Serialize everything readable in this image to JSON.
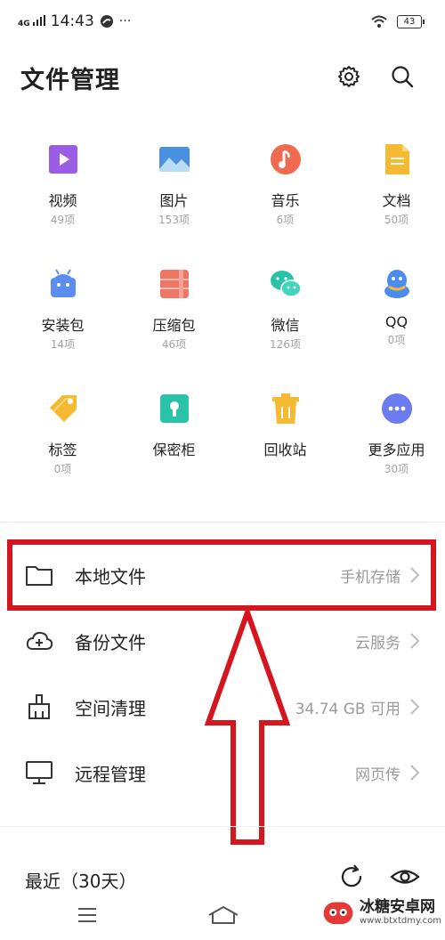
{
  "status_bar": {
    "network": "4G",
    "time": "14:43",
    "extra": "···",
    "battery": "43"
  },
  "header": {
    "title": "文件管理"
  },
  "categories": [
    {
      "label": "视频",
      "count": "49项",
      "icon": "video-icon",
      "color": "#9b5de5"
    },
    {
      "label": "图片",
      "count": "153项",
      "icon": "image-icon",
      "color": "#4a90e2"
    },
    {
      "label": "音乐",
      "count": "6项",
      "icon": "music-icon",
      "color": "#f06a50"
    },
    {
      "label": "文档",
      "count": "50项",
      "icon": "document-icon",
      "color": "#f5b932"
    },
    {
      "label": "安装包",
      "count": "14项",
      "icon": "android-icon",
      "color": "#5b8ef0"
    },
    {
      "label": "压缩包",
      "count": "46项",
      "icon": "archive-icon",
      "color": "#f27462"
    },
    {
      "label": "微信",
      "count": "126项",
      "icon": "wechat-icon",
      "color": "#2bc3a8"
    },
    {
      "label": "QQ",
      "count": "0项",
      "icon": "qq-icon",
      "color": "#4a8cf0"
    },
    {
      "label": "标签",
      "count": "0项",
      "icon": "tag-icon",
      "color": "#f5b932"
    },
    {
      "label": "保密柜",
      "count": "",
      "icon": "safe-icon",
      "color": "#2bc3a8"
    },
    {
      "label": "回收站",
      "count": "",
      "icon": "trash-icon",
      "color": "#f5b932"
    },
    {
      "label": "更多应用",
      "count": "30项",
      "icon": "more-icon",
      "color": "#6b7cf0"
    }
  ],
  "rows": [
    {
      "label": "本地文件",
      "value": "手机存储",
      "icon": "folder-icon"
    },
    {
      "label": "备份文件",
      "value": "云服务",
      "icon": "cloud-icon"
    },
    {
      "label": "空间清理",
      "value": "34.74 GB 可用",
      "icon": "broom-icon"
    },
    {
      "label": "远程管理",
      "value": "网页传",
      "icon": "monitor-icon"
    }
  ],
  "recent": {
    "label": "最近（30天）"
  },
  "watermark": {
    "name": "冰糖安卓网",
    "url": "www.btxtdmy.com"
  },
  "colors": {
    "highlight": "#d5161e",
    "accent_red": "#d5161e"
  }
}
